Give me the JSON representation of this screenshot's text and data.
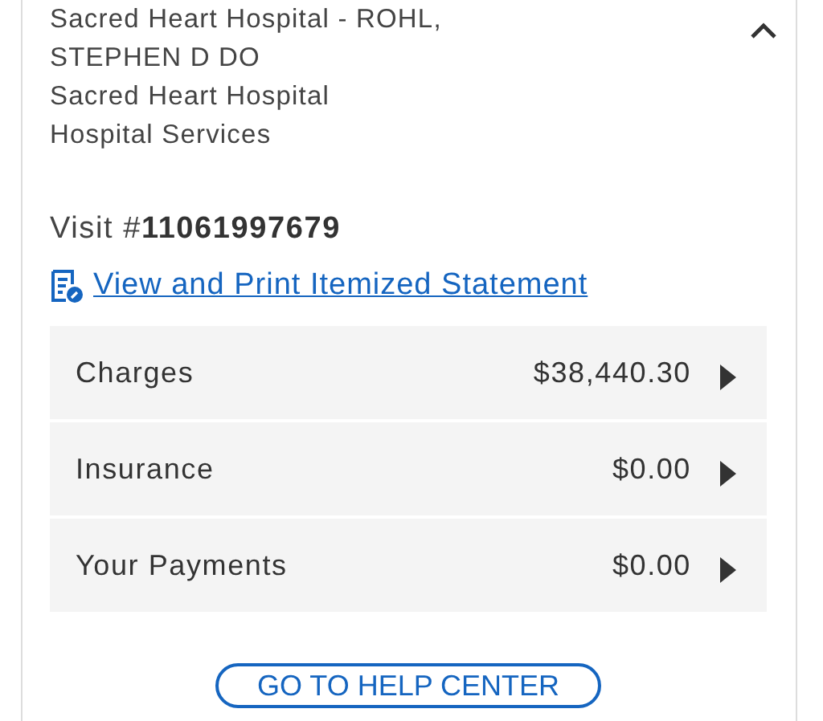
{
  "visit_card": {
    "expanded": true,
    "details": [
      "Sacred Heart Hospital - ROHL,",
      "STEPHEN D DO",
      "Sacred Heart Hospital",
      "Hospital Services"
    ],
    "visit_label": "Visit #",
    "visit_number": "11061997679",
    "statement_link": "View and Print Itemized Statement",
    "summary_rows": [
      {
        "label": "Charges",
        "amount": "$38,440.30"
      },
      {
        "label": "Insurance",
        "amount": "$0.00"
      },
      {
        "label": "Your Payments",
        "amount": "$0.00"
      }
    ],
    "help_button": "GO TO HELP CENTER"
  }
}
